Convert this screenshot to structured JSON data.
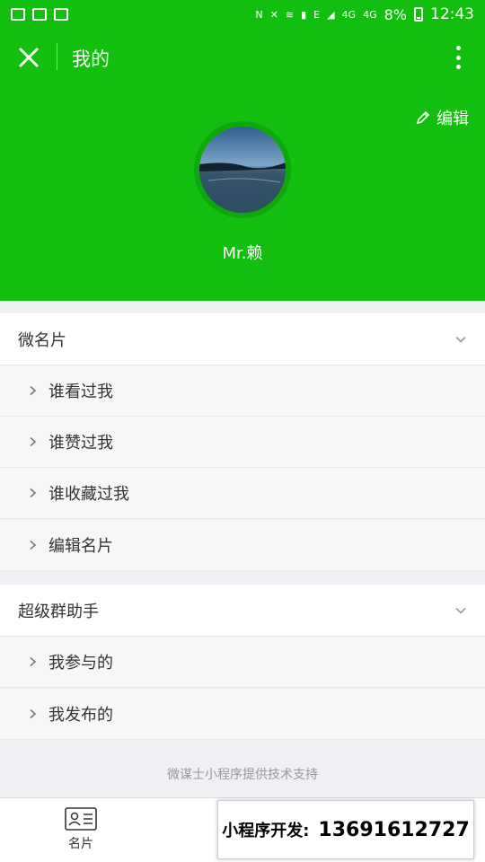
{
  "status_bar": {
    "network_label": "4G",
    "network_label_2": "4G",
    "edge_label": "E",
    "battery": "8%",
    "time": "12:43"
  },
  "header": {
    "title": "我的",
    "edit_label": "编辑",
    "user_name": "Mr.赖"
  },
  "sections": [
    {
      "title": "微名片",
      "items": [
        "谁看过我",
        "谁赞过我",
        "谁收藏过我",
        "编辑名片"
      ]
    },
    {
      "title": "超级群助手",
      "items": [
        "我参与的",
        "我发布的"
      ]
    }
  ],
  "footer_text": "微谋士小程序提供技术支持",
  "tab_bar": {
    "card_label": "名片"
  },
  "promo": {
    "label": "小程序开发:",
    "phone": "13691612727"
  },
  "colors": {
    "brand_green": "#12bf0f",
    "background": "#efeff4"
  }
}
